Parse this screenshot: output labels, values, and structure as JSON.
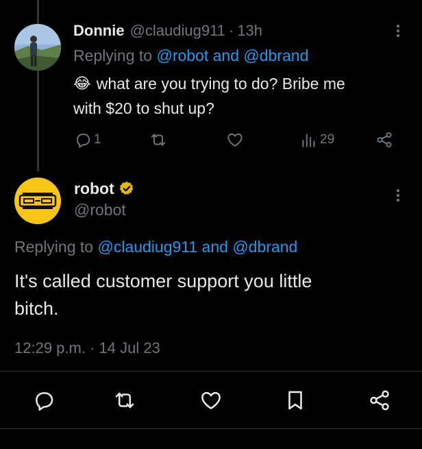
{
  "reply_tweet": {
    "display_name": "Donnie",
    "handle": "@claudiug911",
    "separator": "·",
    "time": "13h",
    "replying_prefix": "Replying to",
    "replying_targets": "@robot and @dbrand",
    "emoji": "😂",
    "text_line1": "what are you trying to do? Bribe me",
    "text_line2": "with $20 to shut up?",
    "reply_count": "1",
    "view_count": "29"
  },
  "main_tweet": {
    "display_name": "robot",
    "handle": "@robot",
    "replying_prefix": "Replying to",
    "replying_targets": "@claudiug911 and @dbrand",
    "text_line1": "It's called customer support you little",
    "text_line2": "bitch.",
    "time": "12:29 p.m.",
    "separator": "·",
    "date": "14 Jul 23"
  },
  "colors": {
    "background": "#000000",
    "text": "#e7e9ea",
    "muted": "#71767b",
    "link": "#1d9bf0",
    "verified": "#e2b719",
    "avatar_robot": "#f6c515"
  },
  "icons": {
    "reply": "comment-icon",
    "retweet": "retweet-icon",
    "like": "heart-icon",
    "views": "views-icon",
    "share": "share-icon",
    "bookmark": "bookmark-icon",
    "more": "more-icon"
  }
}
